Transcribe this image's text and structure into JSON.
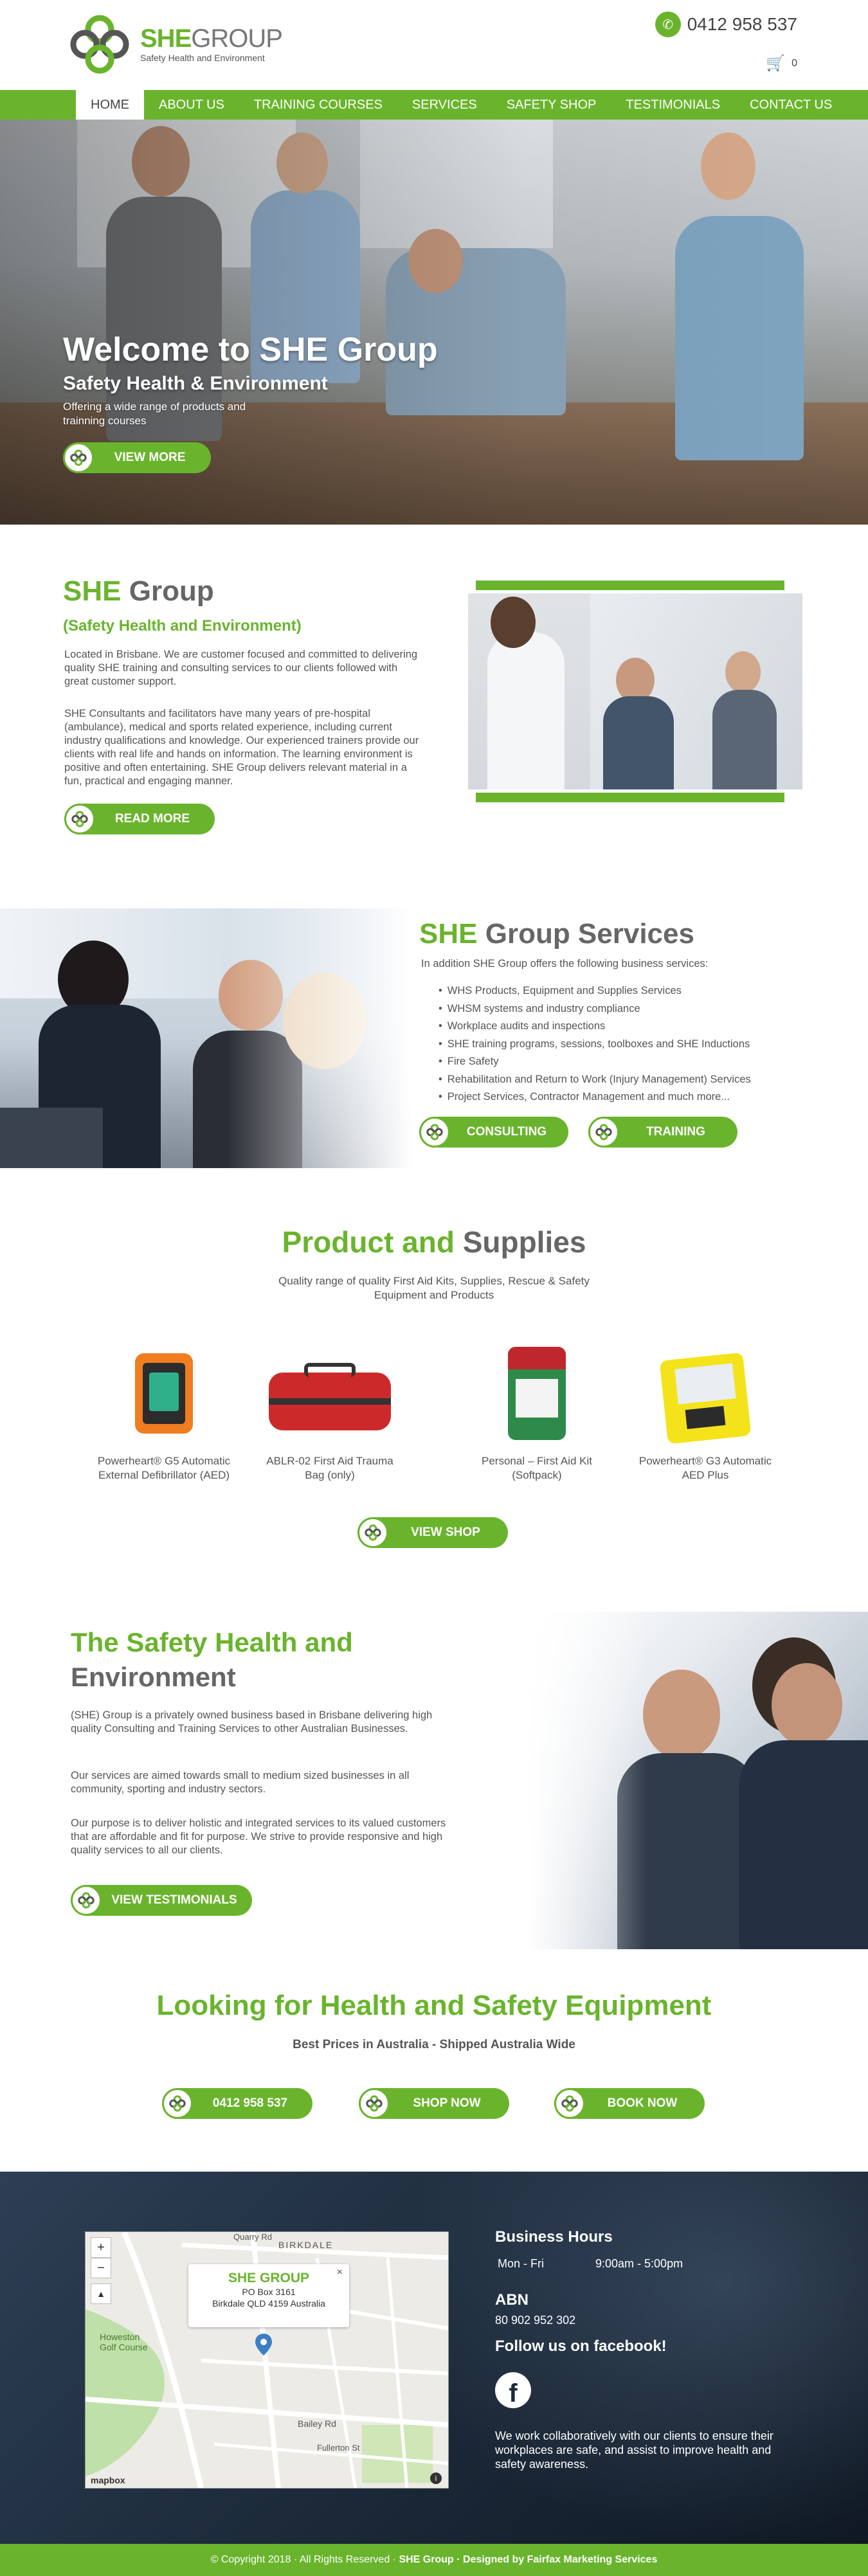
{
  "header": {
    "logo_brand_bold": "SHE",
    "logo_brand_rest": "GROUP",
    "logo_tagline": "Safety Health and Environment",
    "phone": "0412 958 537",
    "cart_count": "0"
  },
  "nav": {
    "items": [
      {
        "label": "HOME"
      },
      {
        "label": "ABOUT US"
      },
      {
        "label": "TRAINING COURSES"
      },
      {
        "label": "SERVICES"
      },
      {
        "label": "SAFETY SHOP"
      },
      {
        "label": "TESTIMONIALS"
      },
      {
        "label": "CONTACT US"
      }
    ],
    "active": "HOME"
  },
  "hero": {
    "title": "Welcome to SHE Group",
    "subtitle": "Safety Health & Environment",
    "description": "Offering a wide range of products and trainning courses",
    "button": "VIEW MORE"
  },
  "about": {
    "title_green": "SHE",
    "title_grey": "Group",
    "subtitle": "(Safety Health and Environment)",
    "p1": "Located in Brisbane. We are customer focused and committed to delivering quality SHE training and consulting services to our clients followed with great customer support.",
    "p2": "SHE Consultants and facilitators have many years of pre-hospital (ambulance), medical and sports related experience, including current industry qualifications and knowledge. Our experienced trainers provide our clients with real life and hands on information. The learning environment is positive and often entertaining. SHE Group delivers relevant material in a fun, practical and engaging manner.",
    "button": "READ MORE"
  },
  "services": {
    "title_green": "SHE",
    "title_grey": "Group Services",
    "intro": "In addition SHE Group offers the following business services:",
    "items": [
      "WHS Products, Equipment and Supplies Services",
      "WHSM systems and industry compliance",
      "Workplace audits and inspections",
      "SHE training programs, sessions, toolboxes and SHE Inductions",
      "Fire Safety",
      "Rehabilitation and Return to Work (Injury Management) Services",
      "Project Services, Contractor Management and much more..."
    ],
    "button_consulting": "CONSULTING",
    "button_training": "TRAINING"
  },
  "products": {
    "title_green": "Product and",
    "title_grey": "Supplies",
    "subtitle": "Quality range of quality First Aid Kits, Supplies, Rescue & Safety Equipment and Products",
    "items": [
      {
        "name": "Powerheart® G5 Automatic External Defibrillator (AED)"
      },
      {
        "name": "ABLR-02 First Aid Trauma Bag (only)"
      },
      {
        "name": "Personal – First Aid Kit (Softpack)"
      },
      {
        "name": "Powerheart® G3 Automatic AED Plus"
      }
    ],
    "button": "VIEW SHOP"
  },
  "safety": {
    "title_green": "The Safety Health and",
    "title_grey": "Environment",
    "p1": "(SHE) Group is a privately owned business based in Brisbane delivering high quality Consulting and Training Services to other Australian Businesses.",
    "p2": "Our services are aimed towards small to medium sized businesses in all community, sporting and industry sectors.",
    "p3": "Our purpose is to deliver holistic and integrated services to its valued customers that are affordable and fit for purpose.  We strive to provide responsive and high quality services to all our clients.",
    "button": "VIEW TESTIMONIALS"
  },
  "looking": {
    "title": "Looking for Health and Safety Equipment",
    "subtitle": "Best Prices in Australia - Shipped Australia Wide",
    "button_phone": "0412 958 537",
    "button_shop": "SHOP NOW",
    "button_book": "BOOK NOW"
  },
  "footer": {
    "map": {
      "popup_title": "SHE GROUP",
      "popup_line1": "PO Box 3161",
      "popup_line2": "Birkdale QLD 4159 Australia",
      "label_birkdale": "BIRKDALE",
      "label_golf": "Howeston Golf Course",
      "label_quarry": "Quarry Rd",
      "label_bailey": "Bailey Rd",
      "label_fullerton": "Fullerton St",
      "label_mapbox": "mapbox"
    },
    "hours_heading": "Business Hours",
    "hours_days": "Mon - Fri",
    "hours_time": "9:00am - 5:00pm",
    "abn_heading": "ABN",
    "abn_value": "80 902 952 302",
    "facebook_heading": "Follow us on facebook!",
    "about_text": "We work collaboratively with our clients to ensure their workplaces are safe, and assist to improve health and safety awareness.",
    "copyright_a": "© Copyright 2018 · All Rights Reserved · ",
    "copyright_b": "SHE Group · Designed by Fairfax Marketing Services"
  },
  "colors": {
    "accent": "#6ab42d",
    "footer_bg": "#1c2a3a"
  }
}
